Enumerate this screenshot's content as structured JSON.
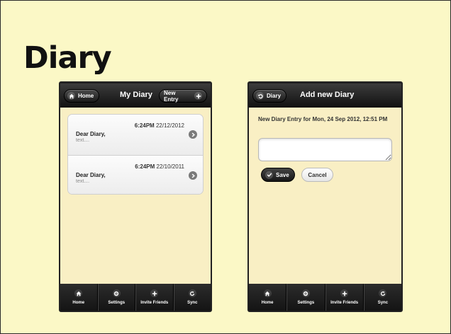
{
  "slide": {
    "title": "Diary"
  },
  "list_screen": {
    "header": {
      "home_label": "Home",
      "title": "My Diary",
      "new_entry_label": "New Entry"
    },
    "entries": [
      {
        "time": "6:24PM",
        "date": "22/12/2012",
        "title": "Dear Diary,",
        "preview": "text...."
      },
      {
        "time": "6:24PM",
        "date": "22/10/2011",
        "title": "Dear Diary,",
        "preview": "text...."
      }
    ],
    "navbar": [
      {
        "label": "Home",
        "icon": "home-icon"
      },
      {
        "label": "Settings",
        "icon": "gear-icon"
      },
      {
        "label": "Invite Friends",
        "icon": "plus-icon"
      },
      {
        "label": "Sync",
        "icon": "refresh-icon"
      }
    ]
  },
  "add_screen": {
    "header": {
      "back_label": "Diary",
      "title": "Add new Diary"
    },
    "form": {
      "label": "New Diary Entry for Mon, 24 Sep 2012, 12:51 PM",
      "input_value": "",
      "save_label": "Save",
      "cancel_label": "Cancel"
    },
    "navbar": [
      {
        "label": "Home",
        "icon": "home-icon"
      },
      {
        "label": "Settings",
        "icon": "gear-icon"
      },
      {
        "label": "Invite Friends",
        "icon": "plus-icon"
      },
      {
        "label": "Sync",
        "icon": "refresh-icon"
      }
    ]
  },
  "colors": {
    "slide_background": "#fbf8c6",
    "content_background": "#f9efc4",
    "header_dark": "#1a1a1a"
  }
}
